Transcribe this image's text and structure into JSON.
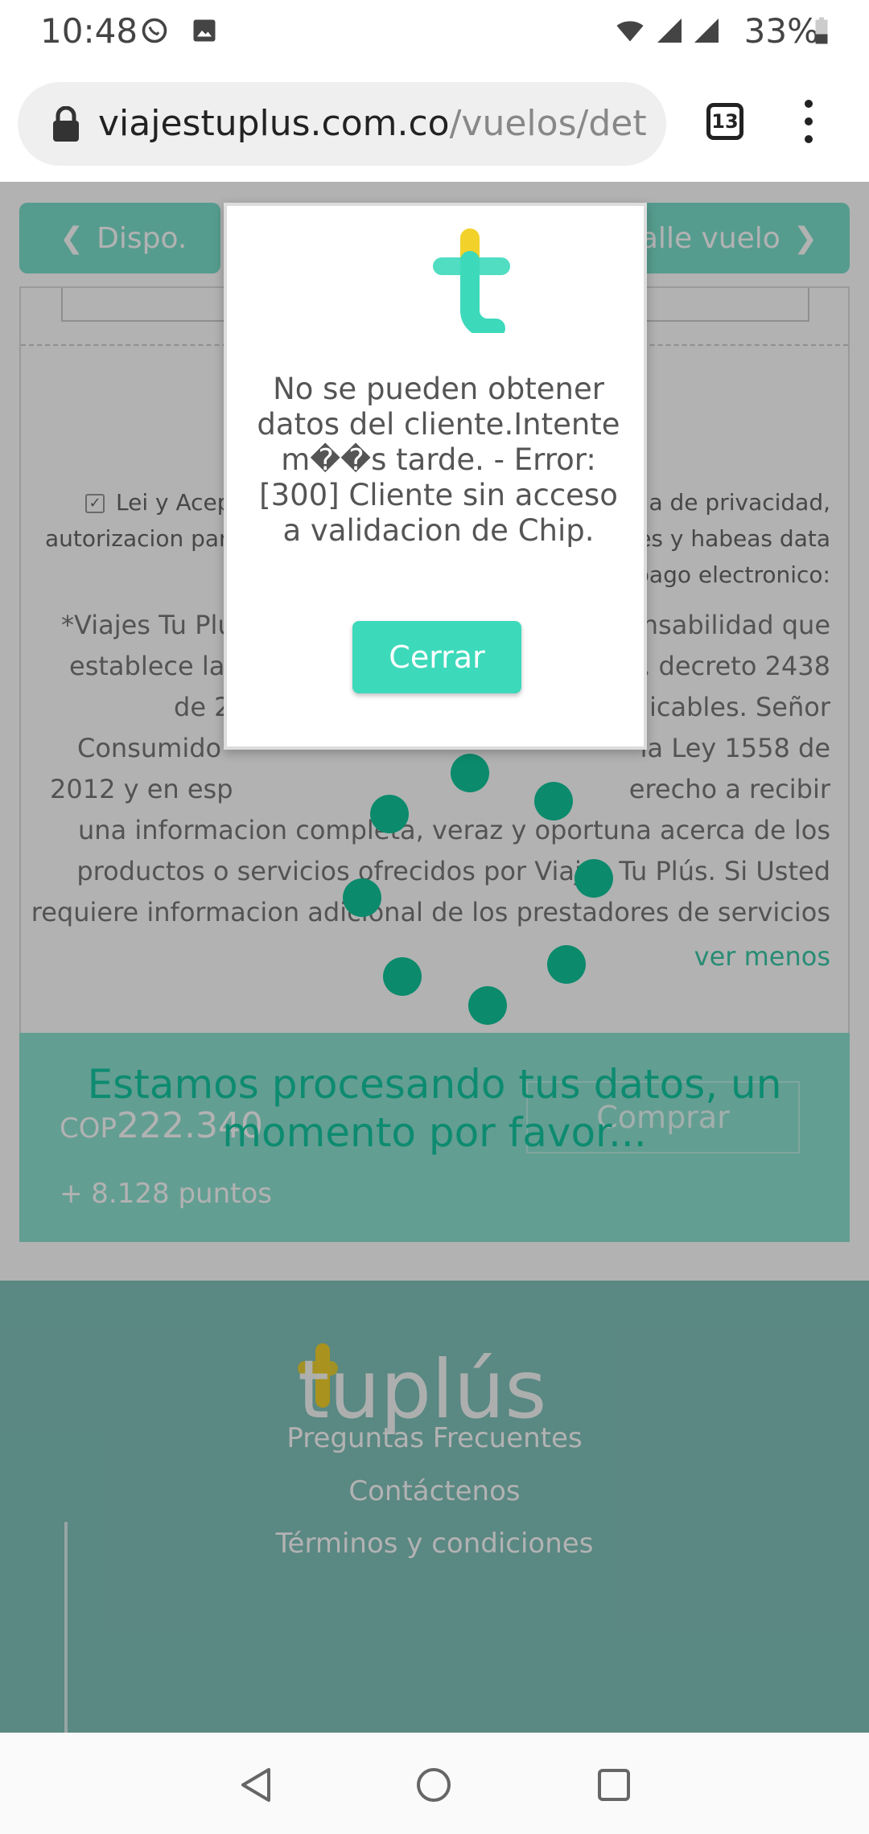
{
  "status_bar": {
    "time": "10:48",
    "battery": "33%",
    "icons": [
      "whatsapp-icon",
      "image-icon",
      "wifi-icon",
      "signal-icon",
      "signal-icon",
      "battery-icon"
    ]
  },
  "browser": {
    "url_domain": "viajestuplus.com.co",
    "url_path": "/vuelos/det",
    "tab_count": "13"
  },
  "page": {
    "nav_back_label": "Dispo.",
    "nav_next_label": "Detalle vuelo",
    "terms_lines": [
      "Lei y Acep",
      "a de privacidad,",
      "autorizacion par",
      "es y habeas data",
      "pago electronico:"
    ],
    "body_lines": [
      "*Viajes Tu Plú",
      "nsabilidad que",
      "establece la",
      "7, decreto 2438",
      "de 2",
      "licables. Señor",
      "Consumido",
      "la Ley 1558 de",
      "2012 y en esp",
      "erecho a recibir",
      "una informacion completa, veraz y oportuna acerca de los",
      "productos o servicios ofrecidos por Viajes Tu Plús. Si Usted",
      "requiere informacion adicional de los prestadores de servicios"
    ],
    "ver_menos": "ver menos",
    "price_currency": "COP",
    "price_value": "222.340",
    "points": "+ 8.128 puntos",
    "buy_label": "Comprar",
    "footer_logo": "tuplús",
    "footer_links": [
      "Preguntas Frecuentes",
      "Contáctenos",
      "Términos y condiciones"
    ]
  },
  "loader": {
    "message": "Estamos procesando tus datos, un momento por favor..."
  },
  "modal": {
    "message": "No se pueden obtener datos del cliente.Intente m��s tarde. - Error: [300] Cliente sin acceso a validacion de Chip.",
    "close_label": "Cerrar"
  },
  "colors": {
    "accent": "#3dd9bb",
    "loader_dot": "#0b8a6c",
    "logo_yellow": "#f2d12a",
    "logo_teal": "#3dd9bb"
  }
}
